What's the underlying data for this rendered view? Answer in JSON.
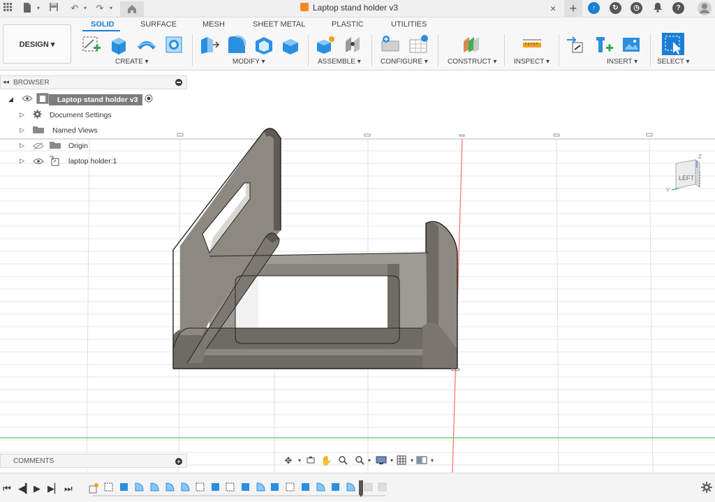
{
  "window": {
    "document_title": "Laptop stand holder v3",
    "close_label": "×",
    "new_tab_label": "+"
  },
  "toolbar": {
    "workspace_label": "DESIGN ▾",
    "tabs": [
      "SOLID",
      "SURFACE",
      "MESH",
      "SHEET METAL",
      "PLASTIC",
      "UTILITIES"
    ],
    "active_tab": "SOLID",
    "groups": [
      "CREATE ▾",
      "MODIFY ▾",
      "ASSEMBLE ▾",
      "CONFIGURE ▾",
      "CONSTRUCT ▾",
      "INSPECT ▾",
      "INSERT ▾",
      "SELECT ▾"
    ]
  },
  "browser": {
    "title": "BROWSER",
    "collapse_glyph": "◂◂",
    "root": "Laptop stand holder v3",
    "items": [
      "Document Settings",
      "Named Views",
      "Origin",
      "laptop holder:1"
    ]
  },
  "viewcube": {
    "face_label": "LEFT",
    "axis_z": "Z",
    "axis_y": "Y"
  },
  "comments": {
    "title": "COMMENTS",
    "add_glyph": "+"
  },
  "timeline": {
    "settings_icon": "gear-icon"
  },
  "colors": {
    "accent": "#1a7fd4",
    "model_face": "#7f7b75",
    "model_light": "#b3afa8",
    "x_axis": "#ff6a6a",
    "y_axis": "#5cc26b",
    "grid": "#e6e6e6"
  }
}
